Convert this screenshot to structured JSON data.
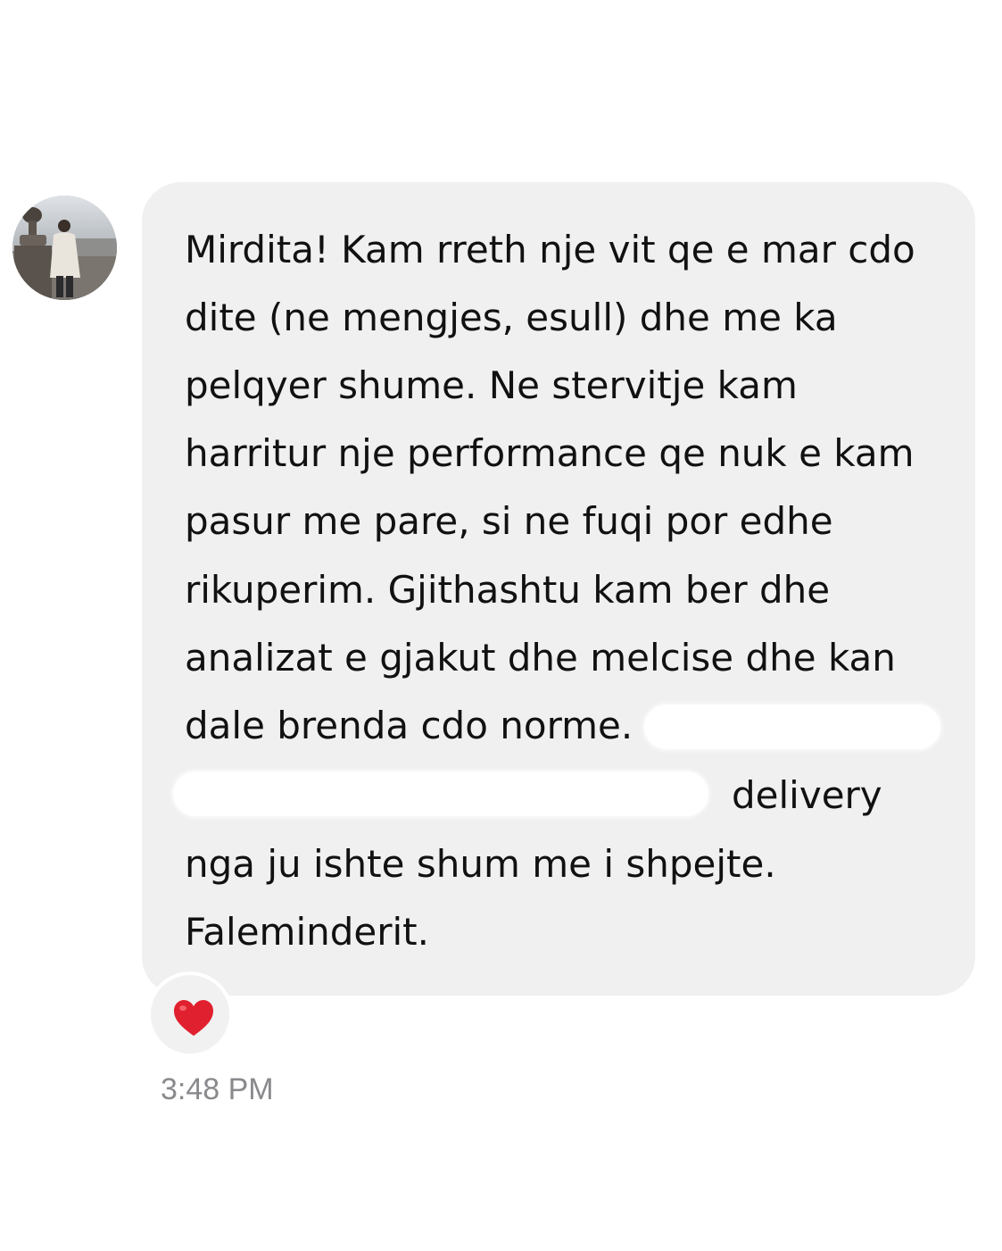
{
  "conversation": {
    "sender": {
      "avatar_icon": "profile-photo-avatar"
    },
    "message": {
      "lines": [
        "Mirdita! Kam rreth nje vit qe e mar cdo",
        "dite (ne mengjes, esull) dhe me ka",
        "pelqyer shume. Ne stervitje kam",
        "harritur nje performance qe nuk e kam",
        "pasur me pare, si ne fuqi por edhe",
        "rikuperim. Gjithashtu kam ber dhe",
        "analizat e gjakut dhe melcise dhe kan",
        "dale brenda cdo norme.",
        "delivery",
        "nga ju ishte shum me i shpejte.",
        "Faleminderit."
      ],
      "bubble_color": "#f0f0f1",
      "text_color": "#111111"
    },
    "reaction": {
      "emoji_icon": "red-heart-icon",
      "color": "#e0202e"
    },
    "timestamp": "3:48 PM"
  }
}
